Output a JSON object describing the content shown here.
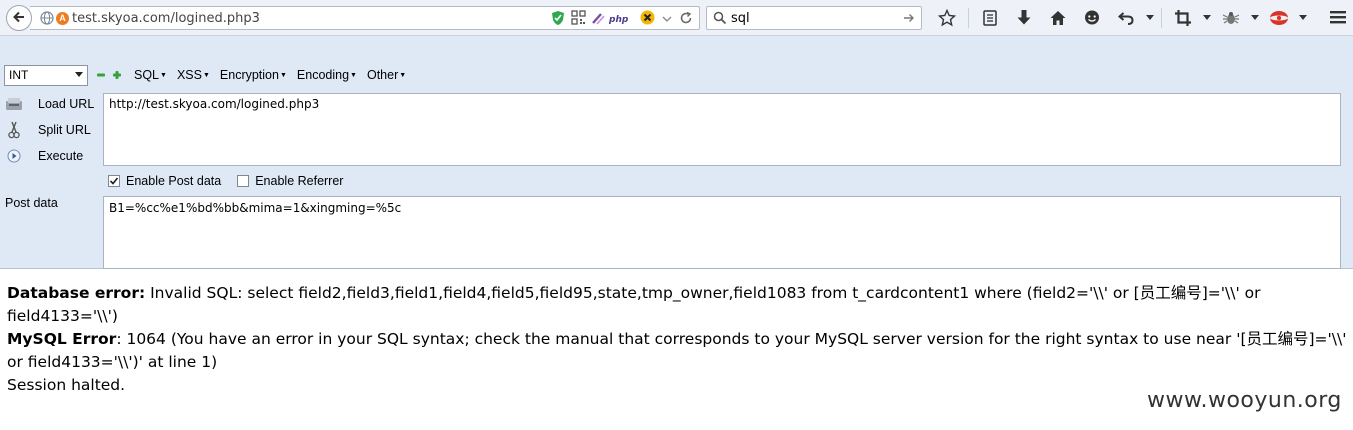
{
  "browser": {
    "url": "test.skyoa.com/logined.php3",
    "search_value": "sql"
  },
  "hackbar": {
    "type_select": "INT",
    "menus": [
      {
        "label": "SQL"
      },
      {
        "label": "XSS"
      },
      {
        "label": "Encryption"
      },
      {
        "label": "Encoding"
      },
      {
        "label": "Other"
      }
    ],
    "buttons": {
      "load_url": "Load URL",
      "split_url": "Split URL",
      "execute": "Execute"
    },
    "url_value": "http://test.skyoa.com/logined.php3",
    "enable_post": {
      "label": "Enable Post data",
      "checked": true
    },
    "enable_referrer": {
      "label": "Enable Referrer",
      "checked": false
    },
    "post_label": "Post data",
    "post_value": "B1=%cc%e1%bd%bb&mima=1&xingming=%5c"
  },
  "page": {
    "db_error_label": "Database error:",
    "db_error_text": " Invalid SQL: select field2,field3,field1,field4,field5,field95,state,tmp_owner,field1083 from t_cardcontent1 where (field2='\\\\' or [员工编号]='\\\\' or field4133='\\\\')",
    "mysql_error_label": "MySQL Error",
    "mysql_error_text": ": 1064 (You have an error in your SQL syntax; check the manual that corresponds to your MySQL server version for the right syntax to use near '[员工编号]='\\\\' or field4133='\\\\')' at line 1)",
    "session_text": "Session halted.",
    "watermark": "www.wooyun.org"
  },
  "icons": [
    "back-arrow-icon",
    "globe-icon",
    "shield-icon",
    "qr-icon",
    "php-icon",
    "x-icon",
    "dropdown-icon",
    "reload-icon",
    "search-icon",
    "star-icon",
    "reading-list-icon",
    "download-icon",
    "home-icon",
    "chat-icon",
    "undo-icon",
    "crop-icon",
    "bug-icon",
    "addon-icon",
    "menu-icon"
  ],
  "colors": {
    "navbar": "#eef2f8",
    "hackbar": "#dfe9f6",
    "shield": "#2fa84f",
    "php": "#7b4fa0",
    "x_badge": "#f2b705"
  }
}
